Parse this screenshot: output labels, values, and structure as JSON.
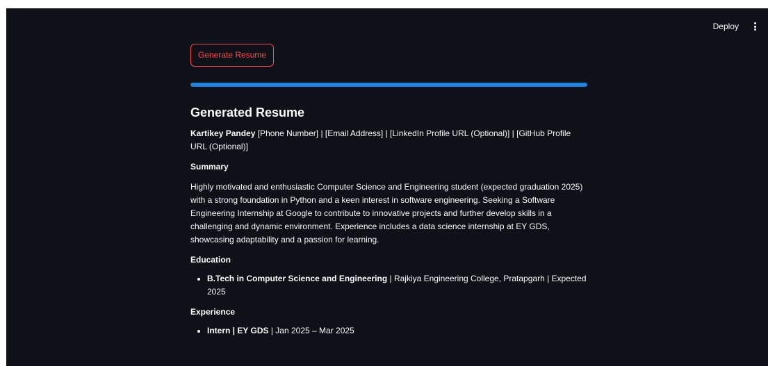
{
  "header": {
    "deploy_label": "Deploy",
    "menu_icon": "vertical-dots-icon"
  },
  "actions": {
    "generate_label": "Generate Resume"
  },
  "progress": {
    "value_percent": 100,
    "color": "#1c83e1"
  },
  "resume": {
    "title": "Generated Resume",
    "name": "Kartikey Pandey",
    "contact_rest": " [Phone Number] | [Email Address] | [LinkedIn Profile URL (Optional)] | [GitHub Profile URL (Optional)]",
    "summary_heading": "Summary",
    "summary_text": "Highly motivated and enthusiastic Computer Science and Engineering student (expected graduation 2025) with a strong foundation in Python and a keen interest in software engineering. Seeking a Software Engineering Internship at Google to contribute to innovative projects and further develop skills in a challenging and dynamic environment. Experience includes a data science internship at EY GDS, showcasing adaptability and a passion for learning.",
    "education_heading": "Education",
    "education": [
      {
        "degree": "B.Tech in Computer Science and Engineering",
        "details": " | Rajkiya Engineering College, Pratapgarh | Expected 2025"
      }
    ],
    "experience_heading": "Experience",
    "experience": [
      {
        "role": "Intern",
        "separator": " | ",
        "company": "EY GDS",
        "dates": " | Jan 2025 – Mar 2025"
      }
    ]
  },
  "colors": {
    "background": "#0e1117",
    "accent": "#ff4b4b",
    "text": "#fafafa"
  }
}
